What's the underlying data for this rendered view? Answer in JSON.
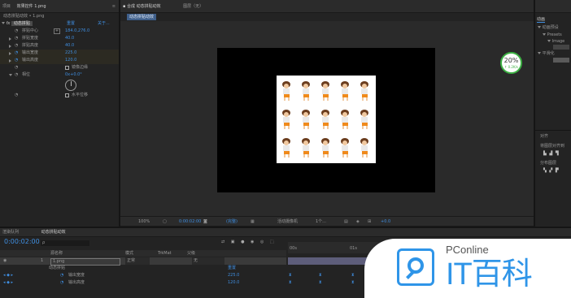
{
  "project_panel": {
    "tab": "项目",
    "effects_tab": "效果控件 1.png"
  },
  "effects": {
    "layer_path": "动态拼贴动效 • 1.png",
    "effect_name": "动态拼贴",
    "reset_label": "重置",
    "about_label": "关于...",
    "props": [
      {
        "label": "拼贴中心",
        "value": "184.0,276.0"
      },
      {
        "label": "拼贴宽度",
        "value": "40.0"
      },
      {
        "label": "拼贴高度",
        "value": "40.0"
      },
      {
        "label": "输出宽度",
        "value": "225.0"
      },
      {
        "label": "输出高度",
        "value": "120.0"
      },
      {
        "label": "镜像边缘",
        "value": ""
      },
      {
        "label": "相位",
        "value": "0x+0.0°"
      },
      {
        "label": "水平位移",
        "value": ""
      }
    ]
  },
  "composition": {
    "tab_label": "合成 动态拼贴动效",
    "layer_tab": "图层（无）",
    "comp_chip": "动态拼贴动效",
    "zoom": "100%",
    "timecode": "0:00:02:00",
    "quality": "(完整)",
    "camera": "活动摄像机",
    "views": "1个...",
    "exposure": "+0.0"
  },
  "right_panel": {
    "tab": "动画",
    "preset_title": "动画预设",
    "items": [
      "Presets",
      "Image"
    ],
    "smooth_label": "平滑化",
    "align_tab": "对齐",
    "align_to": "将图层对齐到",
    "distribute": "分布图层"
  },
  "perf_badge": {
    "percent": "20%",
    "speed": "↑ 0.2K/s"
  },
  "timeline": {
    "render_tab": "渲染队列",
    "comp_tab": "动态拼贴动效",
    "timecode": "0:00:02:00",
    "search_placeholder": "ρ",
    "col_source": "源名称",
    "col_mode": "模式",
    "col_trkmat": "TrkMat",
    "col_parent": "父级",
    "layer_index": "1",
    "layer_name": "1.png",
    "layer_mode": "正常",
    "parent_value": "无",
    "effect_group": "动态拼贴",
    "reset_label": "重置",
    "sub_props": [
      {
        "label": "输出宽度",
        "value": "225.0"
      },
      {
        "label": "输出高度",
        "value": "120.0"
      }
    ],
    "ruler": [
      "00s",
      "01s"
    ]
  },
  "watermark": {
    "brand": "PConline",
    "name": "IT百科"
  },
  "colors": {
    "accent": "#3f8ee0",
    "green": "#3cb043",
    "bg": "#232323"
  }
}
